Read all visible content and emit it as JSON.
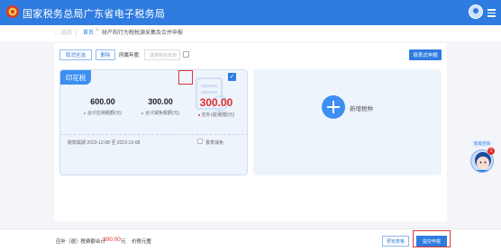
{
  "header": {
    "title": "国家税务总局广东省电子税务局"
  },
  "breadcrumb": {
    "back": "← 返回",
    "home": "首页",
    "arrow": ">",
    "current": "财产和行为税税源采集及合并申报"
  },
  "toolbar": {
    "cancel_label": "取消全选",
    "delete_label": "删除",
    "year_label": "所属年度:",
    "year_placeholder": "选择所在年份",
    "quick_declare_label": "填表式申报"
  },
  "tax_card": {
    "name": "印花税",
    "stats": [
      {
        "value": "600.00",
        "label": "合计应纳税额(元)"
      },
      {
        "value": "300.00",
        "label": "合计减免税额(元)"
      },
      {
        "value": "300.00",
        "label": "应补(退)税额(元)"
      }
    ],
    "period": "税款属期 2023-12-08 至 2023-12-08",
    "relief_label": "置表减免",
    "check_mark": "✓"
  },
  "add_card": {
    "label": "新增税种"
  },
  "floating": {
    "label": "智能咨询",
    "badge": "1"
  },
  "footer": {
    "label": "应补（退）税费额合计",
    "amount": "300.00",
    "unit": "元",
    "tax_label": "价税元整",
    "preview_label": "预览表格",
    "submit_label": "提交申报"
  },
  "colors": {
    "primary": "#2f7ce0",
    "accent_red": "#e22b2b",
    "card_bg": "#eef4fc"
  }
}
